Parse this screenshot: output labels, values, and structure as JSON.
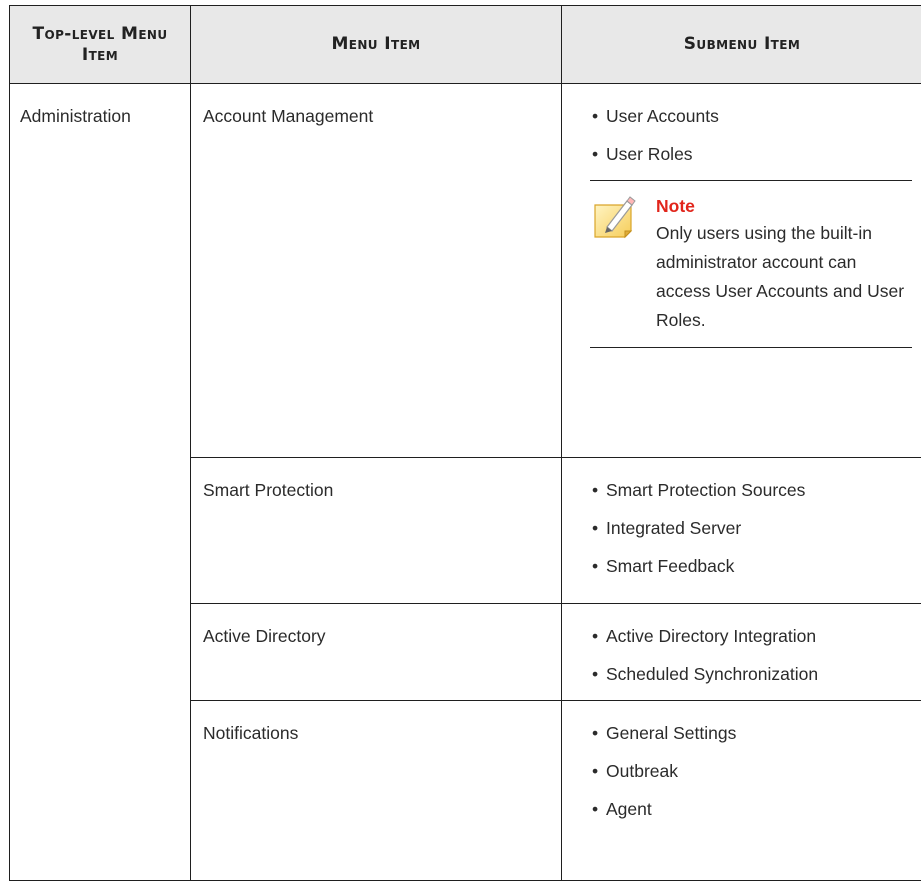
{
  "headers": {
    "top_level": "Top-level Menu Item",
    "menu_item": "Menu Item",
    "submenu_item": "Submenu Item"
  },
  "top_level_item": "Administration",
  "rows": [
    {
      "menu": "Account Management",
      "submenus": [
        "User Accounts",
        "User Roles"
      ],
      "note": {
        "icon": "note-pencil-icon",
        "title": "Note",
        "text": "Only users using the built-in administrator account can access User Accounts and User Roles."
      }
    },
    {
      "menu": "Smart Protection",
      "submenus": [
        "Smart Protection Sources",
        "Integrated Server",
        "Smart Feedback"
      ]
    },
    {
      "menu": "Active Directory",
      "submenus": [
        "Active Directory Integration",
        "Scheduled Synchronization"
      ]
    },
    {
      "menu": "Notifications",
      "submenus": [
        "General Settings",
        "Outbreak",
        "Agent"
      ]
    }
  ],
  "colors": {
    "header_bg": "#e8e8e8",
    "note_title": "#e1251b",
    "border": "#1f1f1f"
  }
}
